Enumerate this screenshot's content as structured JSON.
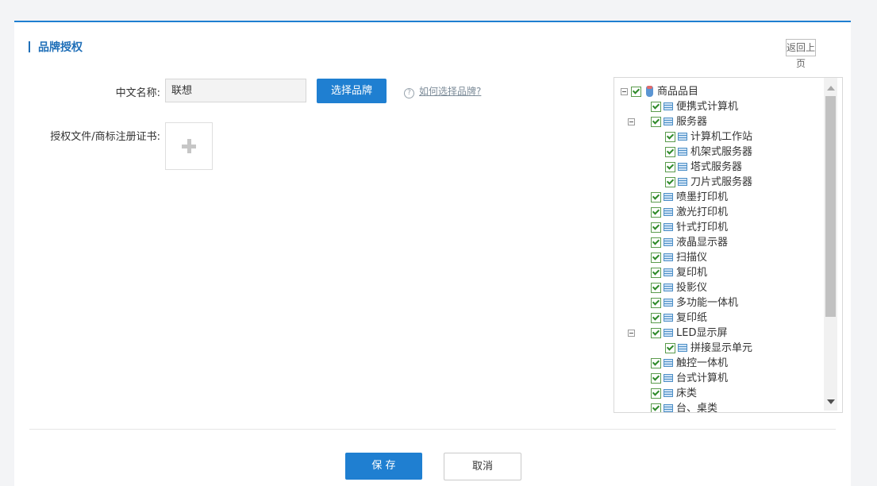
{
  "header": {
    "title": "品牌授权",
    "back_label": "返回上页"
  },
  "form": {
    "chinese_name_label": "中文名称:",
    "chinese_name_value": "联想",
    "select_brand_label": "选择品牌",
    "help_link": "如何选择品牌?",
    "auth_file_label": "授权文件/商标注册证书:"
  },
  "tree": {
    "root": "商品品目",
    "items": [
      {
        "label": "便携式计算机",
        "level": 1,
        "checked": true
      },
      {
        "label": "服务器",
        "level": 1,
        "checked": true,
        "expanded": true
      },
      {
        "label": "计算机工作站",
        "level": 2,
        "checked": true
      },
      {
        "label": "机架式服务器",
        "level": 2,
        "checked": true
      },
      {
        "label": "塔式服务器",
        "level": 2,
        "checked": true
      },
      {
        "label": "刀片式服务器",
        "level": 2,
        "checked": true
      },
      {
        "label": "喷墨打印机",
        "level": 1,
        "checked": true
      },
      {
        "label": "激光打印机",
        "level": 1,
        "checked": true
      },
      {
        "label": "针式打印机",
        "level": 1,
        "checked": true
      },
      {
        "label": "液晶显示器",
        "level": 1,
        "checked": true
      },
      {
        "label": "扫描仪",
        "level": 1,
        "checked": true
      },
      {
        "label": "复印机",
        "level": 1,
        "checked": true
      },
      {
        "label": "投影仪",
        "level": 1,
        "checked": true
      },
      {
        "label": "多功能一体机",
        "level": 1,
        "checked": true
      },
      {
        "label": "复印纸",
        "level": 1,
        "checked": true
      },
      {
        "label": "LED显示屏",
        "level": 1,
        "checked": true,
        "expanded": true
      },
      {
        "label": "拼接显示单元",
        "level": 2,
        "checked": true
      },
      {
        "label": "触控一体机",
        "level": 1,
        "checked": true
      },
      {
        "label": "台式计算机",
        "level": 1,
        "checked": true
      },
      {
        "label": "床类",
        "level": 1,
        "checked": true
      },
      {
        "label": "台、桌类",
        "level": 1,
        "checked": true
      }
    ]
  },
  "footer": {
    "save_label": "保 存",
    "cancel_label": "取消"
  },
  "colors": {
    "accent": "#1f7fd1",
    "title": "#1f6fb8"
  }
}
